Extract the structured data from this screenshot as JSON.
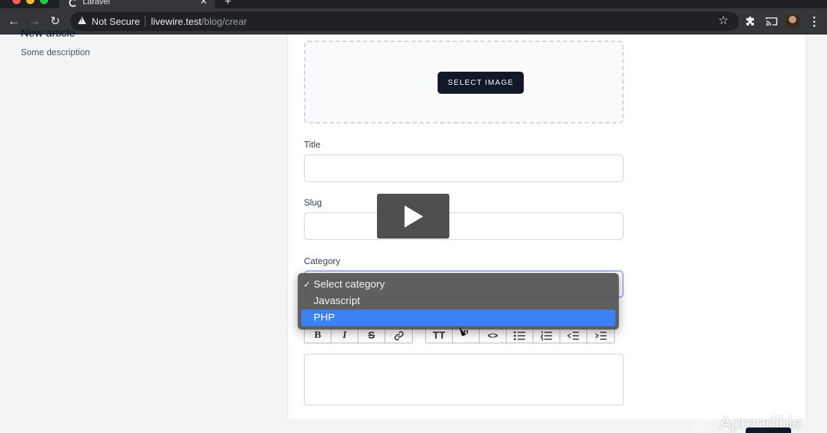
{
  "browser": {
    "tab_title": "Laravel",
    "address": {
      "security_label": "Not Secure",
      "host": "livewire.test",
      "path": "/blog/crear"
    }
  },
  "page": {
    "heading": "New article",
    "description": "Some description"
  },
  "form": {
    "select_image_label": "SELECT IMAGE",
    "title_label": "Title",
    "title_value": "",
    "slug_label": "Slug",
    "slug_value": "",
    "category_label": "Category",
    "category_options": [
      {
        "label": "Select category",
        "selected": true,
        "highlighted": false
      },
      {
        "label": "Javascript",
        "selected": false,
        "highlighted": false
      },
      {
        "label": "PHP",
        "selected": false,
        "highlighted": true
      }
    ],
    "editor_toolbar_icons": [
      "bold-icon",
      "italic-icon",
      "strikethrough-icon",
      "link-icon",
      "heading-icon",
      "quote-icon",
      "code-icon",
      "bullet-list-icon",
      "numbered-list-icon",
      "outdent-icon",
      "indent-icon"
    ]
  },
  "watermark": {
    "text": "Aprendible"
  },
  "colors": {
    "chrome_dark": "#35363a",
    "primary_button": "#111827",
    "highlight": "#3b82f6",
    "focus_ring": "#a5b4fc"
  }
}
